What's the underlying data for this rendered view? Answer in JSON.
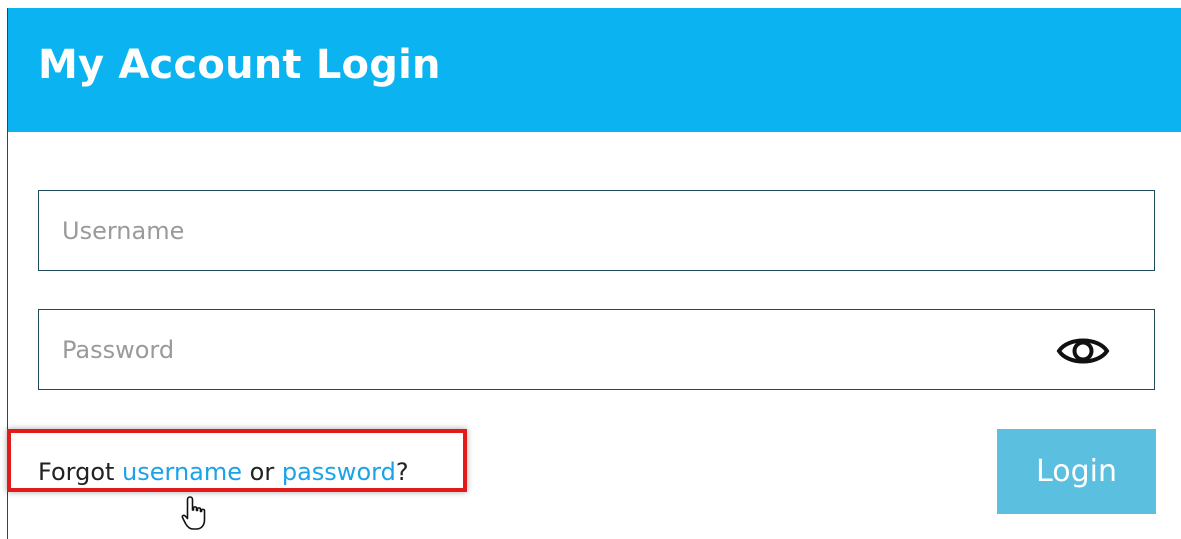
{
  "header": {
    "title": "My Account Login",
    "color": "#0bb4f0"
  },
  "form": {
    "username": {
      "placeholder": "Username",
      "value": ""
    },
    "password": {
      "placeholder": "Password",
      "value": "",
      "toggle_icon": "eye-icon"
    },
    "forgot": {
      "prefix": "Forgot ",
      "username_link": "username",
      "middle": " or ",
      "password_link": "password",
      "suffix": "?"
    },
    "login_label": "Login"
  },
  "colors": {
    "link": "#1aa3e8",
    "button": "#5bbfe0",
    "border": "#1e4a5a",
    "highlight": "#e21a1a"
  }
}
